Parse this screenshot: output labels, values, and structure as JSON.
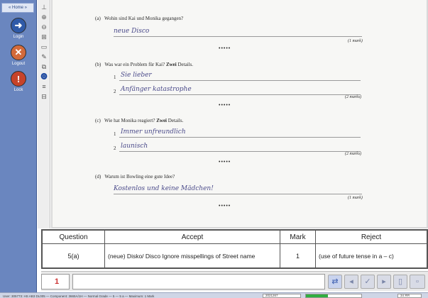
{
  "sidebar": {
    "home_label": "« Home »",
    "login_label": "Login",
    "logout_label": "Logout",
    "lock_label": "Lock"
  },
  "document": {
    "questions": [
      {
        "letter": "(a)",
        "question": "Wohin sind Kai und Monika gegangen?",
        "answers": [
          "neue Disco"
        ],
        "marks": "(1 mark)"
      },
      {
        "letter": "(b)",
        "question": "Was war ein Problem für Kai?",
        "emphasis": "Zwei",
        "question_suffix": "Details.",
        "answers": [
          "Sie lieber",
          "Anfänger katastrophe"
        ],
        "marks": "(2 marks)"
      },
      {
        "letter": "(c)",
        "question": "Wie hat Monika reagiert?",
        "emphasis": "Zwei",
        "question_suffix": "Details.",
        "answers": [
          "Immer unfreundlich",
          "launisch"
        ],
        "marks": "(2 marks)"
      },
      {
        "letter": "(d)",
        "question": "Warum ist Bowling eine gute Idee?",
        "answers": [
          "Kostenlos und keine Mädchen!"
        ],
        "marks": "(1 mark)"
      }
    ],
    "dots": "•••••",
    "line_numbers": [
      "1",
      "2"
    ]
  },
  "mark_scheme": {
    "headers": [
      "Question",
      "Accept",
      "Mark",
      "Reject"
    ],
    "row": {
      "question": "5(a)",
      "accept": "(neue) Disko/ Disco Ignore misspellings of Street name",
      "mark": "1",
      "reject": "(use of future tense in a – c)"
    }
  },
  "input_bar": {
    "mark_value": "1"
  },
  "status_bar": {
    "text": "User: 305773: HS AB3 DL005 — Component: 3665A/1H — Normal Grade — 5 — 5 a — Maximum: 1 Mark",
    "field": "2021267",
    "zoom": "34 ЯЯ",
    "progress_fraction": 0.4
  }
}
